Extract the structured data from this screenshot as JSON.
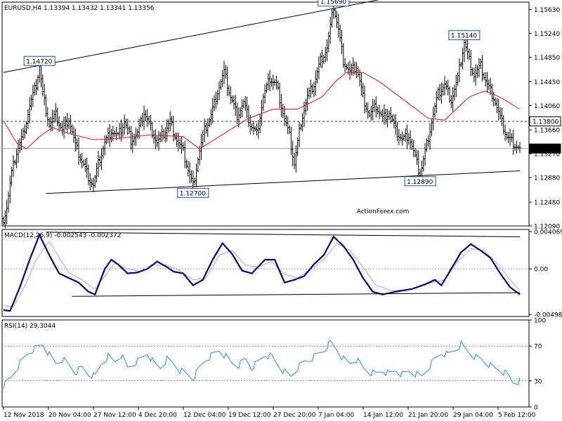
{
  "header": {
    "symbol_line": "EURUSD,H4  1.13394 1.13432 1.13341 1.13356",
    "macd_line": "MACD(12,26,9) -0.002543 -0.002372",
    "rsi_line": "RSI(14) 29.3044"
  },
  "watermark": "ActionForex.com",
  "chart_data": [
    {
      "type": "candlestick",
      "title": "EURUSD,H4",
      "ohlc": [
        1.13394,
        1.13432,
        1.13341,
        1.13356
      ],
      "ylim": [
        1.1209,
        1.1575
      ],
      "y_ticks": [
        "1.15630",
        "1.15240",
        "1.14850",
        "1.14450",
        "1.14060",
        "1.13660",
        "1.13270",
        "1.12880",
        "1.12480",
        "1.12090"
      ],
      "y_tick_values": [
        1.1563,
        1.1524,
        1.1485,
        1.1445,
        1.1406,
        1.1366,
        1.1327,
        1.1288,
        1.1248,
        1.1209
      ],
      "x_ticks": [
        "12 Nov 2018",
        "20 Nov 04:00",
        "27 Nov 12:00",
        "4 Dec 20:00",
        "12 Dec 04:00",
        "19 Dec 12:00",
        "27 Dec 20:00",
        "7 Jan 04:00",
        "14 Jan 12:00",
        "21 Jan 20:00",
        "29 Jan 04:00",
        "5 Feb 12:00"
      ],
      "price_path": [
        [
          0,
          1.1221
        ],
        [
          2,
          1.124
        ],
        [
          5,
          1.1295
        ],
        [
          8,
          1.133
        ],
        [
          12,
          1.1358
        ],
        [
          16,
          1.1405
        ],
        [
          20,
          1.144
        ],
        [
          22,
          1.1472
        ],
        [
          24,
          1.1425
        ],
        [
          28,
          1.1375
        ],
        [
          32,
          1.139
        ],
        [
          36,
          1.1365
        ],
        [
          40,
          1.1385
        ],
        [
          44,
          1.134
        ],
        [
          48,
          1.1315
        ],
        [
          52,
          1.129
        ],
        [
          55,
          1.1275
        ],
        [
          58,
          1.131
        ],
        [
          62,
          1.1345
        ],
        [
          66,
          1.1365
        ],
        [
          70,
          1.1355
        ],
        [
          74,
          1.138
        ],
        [
          78,
          1.135
        ],
        [
          82,
          1.136
        ],
        [
          86,
          1.1395
        ],
        [
          90,
          1.137
        ],
        [
          94,
          1.1345
        ],
        [
          98,
          1.136
        ],
        [
          102,
          1.138
        ],
        [
          106,
          1.135
        ],
        [
          110,
          1.133
        ],
        [
          113,
          1.13
        ],
        [
          116,
          1.1275
        ],
        [
          119,
          1.132
        ],
        [
          123,
          1.1365
        ],
        [
          127,
          1.139
        ],
        [
          131,
          1.143
        ],
        [
          135,
          1.146
        ],
        [
          139,
          1.142
        ],
        [
          143,
          1.139
        ],
        [
          147,
          1.141
        ],
        [
          151,
          1.1375
        ],
        [
          155,
          1.136
        ],
        [
          159,
          1.142
        ],
        [
          163,
          1.145
        ],
        [
          167,
          1.144
        ],
        [
          171,
          1.1395
        ],
        [
          175,
          1.1355
        ],
        [
          178,
          1.131
        ],
        [
          182,
          1.138
        ],
        [
          186,
          1.142
        ],
        [
          190,
          1.144
        ],
        [
          194,
          1.148
        ],
        [
          198,
          1.15
        ],
        [
          202,
          1.1568
        ],
        [
          205,
          1.153
        ],
        [
          208,
          1.148
        ],
        [
          212,
          1.146
        ],
        [
          216,
          1.147
        ],
        [
          220,
          1.142
        ],
        [
          224,
          1.139
        ],
        [
          228,
          1.1405
        ],
        [
          232,
          1.1385
        ],
        [
          236,
          1.1395
        ],
        [
          240,
          1.1365
        ],
        [
          244,
          1.135
        ],
        [
          248,
          1.1358
        ],
        [
          252,
          1.132
        ],
        [
          255,
          1.1292
        ],
        [
          258,
          1.133
        ],
        [
          262,
          1.138
        ],
        [
          266,
          1.1425
        ],
        [
          270,
          1.144
        ],
        [
          274,
          1.1415
        ],
        [
          278,
          1.145
        ],
        [
          282,
          1.151
        ],
        [
          285,
          1.148
        ],
        [
          288,
          1.1455
        ],
        [
          292,
          1.147
        ],
        [
          296,
          1.144
        ],
        [
          300,
          1.142
        ],
        [
          304,
          1.1385
        ],
        [
          308,
          1.1355
        ],
        [
          312,
          1.1345
        ],
        [
          316,
          1.1335
        ]
      ],
      "moving_average": [
        [
          0,
          1.1381
        ],
        [
          8,
          1.1345
        ],
        [
          14,
          1.1335
        ],
        [
          22,
          1.1355
        ],
        [
          30,
          1.137
        ],
        [
          40,
          1.136
        ],
        [
          55,
          1.135
        ],
        [
          70,
          1.1352
        ],
        [
          90,
          1.1358
        ],
        [
          110,
          1.1355
        ],
        [
          120,
          1.1335
        ],
        [
          135,
          1.136
        ],
        [
          150,
          1.1385
        ],
        [
          165,
          1.14
        ],
        [
          180,
          1.14
        ],
        [
          195,
          1.142
        ],
        [
          203,
          1.1445
        ],
        [
          210,
          1.146
        ],
        [
          220,
          1.146
        ],
        [
          230,
          1.1445
        ],
        [
          245,
          1.1415
        ],
        [
          260,
          1.1385
        ],
        [
          270,
          1.1382
        ],
        [
          285,
          1.142
        ],
        [
          295,
          1.143
        ],
        [
          305,
          1.1418
        ],
        [
          316,
          1.14
        ]
      ],
      "trendlines": [
        {
          "from": [
            0,
            1.146
          ],
          "to": [
            232,
            1.158
          ]
        },
        {
          "from": [
            26,
            1.1262
          ],
          "to": [
            316,
            1.1299
          ]
        }
      ],
      "horizontal_line": 1.138,
      "annotations": [
        {
          "text": "1.14720",
          "index": 22,
          "value": 1.1472
        },
        {
          "text": "1.15690",
          "index": 202,
          "value": 1.1569
        },
        {
          "text": "1.15140",
          "index": 282,
          "value": 1.1514
        },
        {
          "text": "1.12700",
          "index": 116,
          "value": 1.127
        },
        {
          "text": "1.12890",
          "index": 255,
          "value": 1.1289
        }
      ],
      "axis_badges": [
        {
          "text": "1.13800",
          "value": 1.138,
          "style": "highlight"
        },
        {
          "text": "1.13356",
          "value": 1.13356,
          "style": "dark"
        }
      ]
    },
    {
      "type": "line",
      "title": "MACD(12,26,9)",
      "values_shown": [
        -0.002543,
        -0.002372
      ],
      "ylim": [
        -0.0052,
        0.0043
      ],
      "y_ticks": [
        "0.004069",
        "0.00",
        "-0.004981"
      ],
      "y_tick_values": [
        0.004069,
        0.0,
        -0.004981
      ],
      "macd_path": [
        [
          0,
          -0.0045
        ],
        [
          4,
          -0.0046
        ],
        [
          10,
          -0.002
        ],
        [
          16,
          0.001
        ],
        [
          22,
          0.0037
        ],
        [
          28,
          0.0015
        ],
        [
          34,
          -0.0005
        ],
        [
          40,
          -0.001
        ],
        [
          46,
          -0.0015
        ],
        [
          52,
          -0.0025
        ],
        [
          56,
          -0.0028
        ],
        [
          62,
          0.0
        ],
        [
          66,
          0.001
        ],
        [
          70,
          0.0005
        ],
        [
          76,
          -0.0005
        ],
        [
          82,
          -0.0004
        ],
        [
          88,
          0.0
        ],
        [
          94,
          0.0008
        ],
        [
          100,
          0.0002
        ],
        [
          104,
          -0.0003
        ],
        [
          110,
          -0.0005
        ],
        [
          116,
          -0.0018
        ],
        [
          122,
          -0.0012
        ],
        [
          128,
          0.001
        ],
        [
          134,
          0.0028
        ],
        [
          140,
          0.0016
        ],
        [
          146,
          -0.0002
        ],
        [
          152,
          -0.0005
        ],
        [
          160,
          0.001
        ],
        [
          166,
          0.001
        ],
        [
          172,
          -0.0015
        ],
        [
          178,
          -0.0012
        ],
        [
          184,
          -0.0008
        ],
        [
          190,
          0.0005
        ],
        [
          196,
          0.0015
        ],
        [
          202,
          0.0035
        ],
        [
          208,
          0.0025
        ],
        [
          214,
          0.001
        ],
        [
          220,
          -0.001
        ],
        [
          226,
          -0.0025
        ],
        [
          232,
          -0.0028
        ],
        [
          240,
          -0.0025
        ],
        [
          250,
          -0.0022
        ],
        [
          258,
          -0.0017
        ],
        [
          264,
          -0.0012
        ],
        [
          268,
          -0.0018
        ],
        [
          274,
          0.0
        ],
        [
          280,
          0.0018
        ],
        [
          286,
          0.0027
        ],
        [
          292,
          0.002
        ],
        [
          298,
          0.0012
        ],
        [
          304,
          -0.0005
        ],
        [
          310,
          -0.002
        ],
        [
          316,
          -0.0028
        ]
      ],
      "signal_path": [
        [
          0,
          -0.004
        ],
        [
          6,
          -0.0042
        ],
        [
          14,
          -0.0015
        ],
        [
          20,
          0.001
        ],
        [
          28,
          0.003
        ],
        [
          34,
          0.0012
        ],
        [
          40,
          -0.0004
        ],
        [
          48,
          -0.0012
        ],
        [
          56,
          -0.0022
        ],
        [
          62,
          -0.0008
        ],
        [
          68,
          0.0006
        ],
        [
          76,
          0.0
        ],
        [
          84,
          -0.0003
        ],
        [
          92,
          0.0004
        ],
        [
          100,
          0.0004
        ],
        [
          108,
          -0.0002
        ],
        [
          116,
          -0.0012
        ],
        [
          124,
          -0.001
        ],
        [
          132,
          0.0015
        ],
        [
          140,
          0.002
        ],
        [
          148,
          0.0004
        ],
        [
          156,
          0.0002
        ],
        [
          164,
          0.0008
        ],
        [
          172,
          -0.0006
        ],
        [
          180,
          -0.001
        ],
        [
          188,
          0.0
        ],
        [
          196,
          0.001
        ],
        [
          204,
          0.0028
        ],
        [
          212,
          0.002
        ],
        [
          220,
          0.0002
        ],
        [
          228,
          -0.0018
        ],
        [
          238,
          -0.0024
        ],
        [
          250,
          -0.0022
        ],
        [
          262,
          -0.0015
        ],
        [
          270,
          -0.0012
        ],
        [
          278,
          0.0008
        ],
        [
          286,
          0.0022
        ],
        [
          294,
          0.002
        ],
        [
          302,
          0.0006
        ],
        [
          310,
          -0.0012
        ],
        [
          316,
          -0.0024
        ]
      ],
      "trendlines": [
        {
          "from": [
            26,
            0.004
          ],
          "to": [
            316,
            0.0035
          ]
        },
        {
          "from": [
            42,
            -0.003
          ],
          "to": [
            316,
            -0.0026
          ]
        }
      ]
    },
    {
      "type": "line",
      "title": "RSI(14)",
      "value_shown": 29.3044,
      "ylim": [
        0,
        100
      ],
      "y_ticks": [
        "100",
        "70",
        "30",
        "0"
      ],
      "y_tick_values": [
        100,
        70,
        30,
        0
      ],
      "levels": [
        70,
        30
      ],
      "rsi_path": [
        [
          0,
          24
        ],
        [
          5,
          35
        ],
        [
          10,
          50
        ],
        [
          15,
          62
        ],
        [
          20,
          68
        ],
        [
          24,
          72
        ],
        [
          28,
          60
        ],
        [
          32,
          50
        ],
        [
          36,
          55
        ],
        [
          40,
          48
        ],
        [
          44,
          40
        ],
        [
          48,
          45
        ],
        [
          52,
          38
        ],
        [
          56,
          35
        ],
        [
          60,
          50
        ],
        [
          64,
          58
        ],
        [
          68,
          52
        ],
        [
          72,
          60
        ],
        [
          76,
          45
        ],
        [
          80,
          50
        ],
        [
          84,
          55
        ],
        [
          88,
          62
        ],
        [
          92,
          50
        ],
        [
          96,
          45
        ],
        [
          100,
          55
        ],
        [
          104,
          50
        ],
        [
          108,
          42
        ],
        [
          112,
          38
        ],
        [
          116,
          33
        ],
        [
          120,
          45
        ],
        [
          124,
          55
        ],
        [
          128,
          60
        ],
        [
          132,
          65
        ],
        [
          136,
          58
        ],
        [
          140,
          50
        ],
        [
          144,
          48
        ],
        [
          148,
          55
        ],
        [
          152,
          45
        ],
        [
          156,
          52
        ],
        [
          160,
          60
        ],
        [
          164,
          58
        ],
        [
          168,
          48
        ],
        [
          172,
          40
        ],
        [
          176,
          35
        ],
        [
          180,
          45
        ],
        [
          184,
          52
        ],
        [
          188,
          55
        ],
        [
          192,
          60
        ],
        [
          196,
          65
        ],
        [
          200,
          74
        ],
        [
          204,
          66
        ],
        [
          208,
          55
        ],
        [
          212,
          50
        ],
        [
          216,
          55
        ],
        [
          220,
          45
        ],
        [
          224,
          40
        ],
        [
          228,
          38
        ],
        [
          232,
          42
        ],
        [
          236,
          38
        ],
        [
          240,
          42
        ],
        [
          244,
          37
        ],
        [
          248,
          41
        ],
        [
          252,
          38
        ],
        [
          256,
          35
        ],
        [
          260,
          45
        ],
        [
          264,
          55
        ],
        [
          268,
          62
        ],
        [
          272,
          60
        ],
        [
          276,
          65
        ],
        [
          280,
          72
        ],
        [
          284,
          64
        ],
        [
          288,
          58
        ],
        [
          292,
          55
        ],
        [
          296,
          50
        ],
        [
          300,
          45
        ],
        [
          304,
          42
        ],
        [
          308,
          38
        ],
        [
          312,
          28
        ],
        [
          316,
          30
        ]
      ]
    }
  ]
}
